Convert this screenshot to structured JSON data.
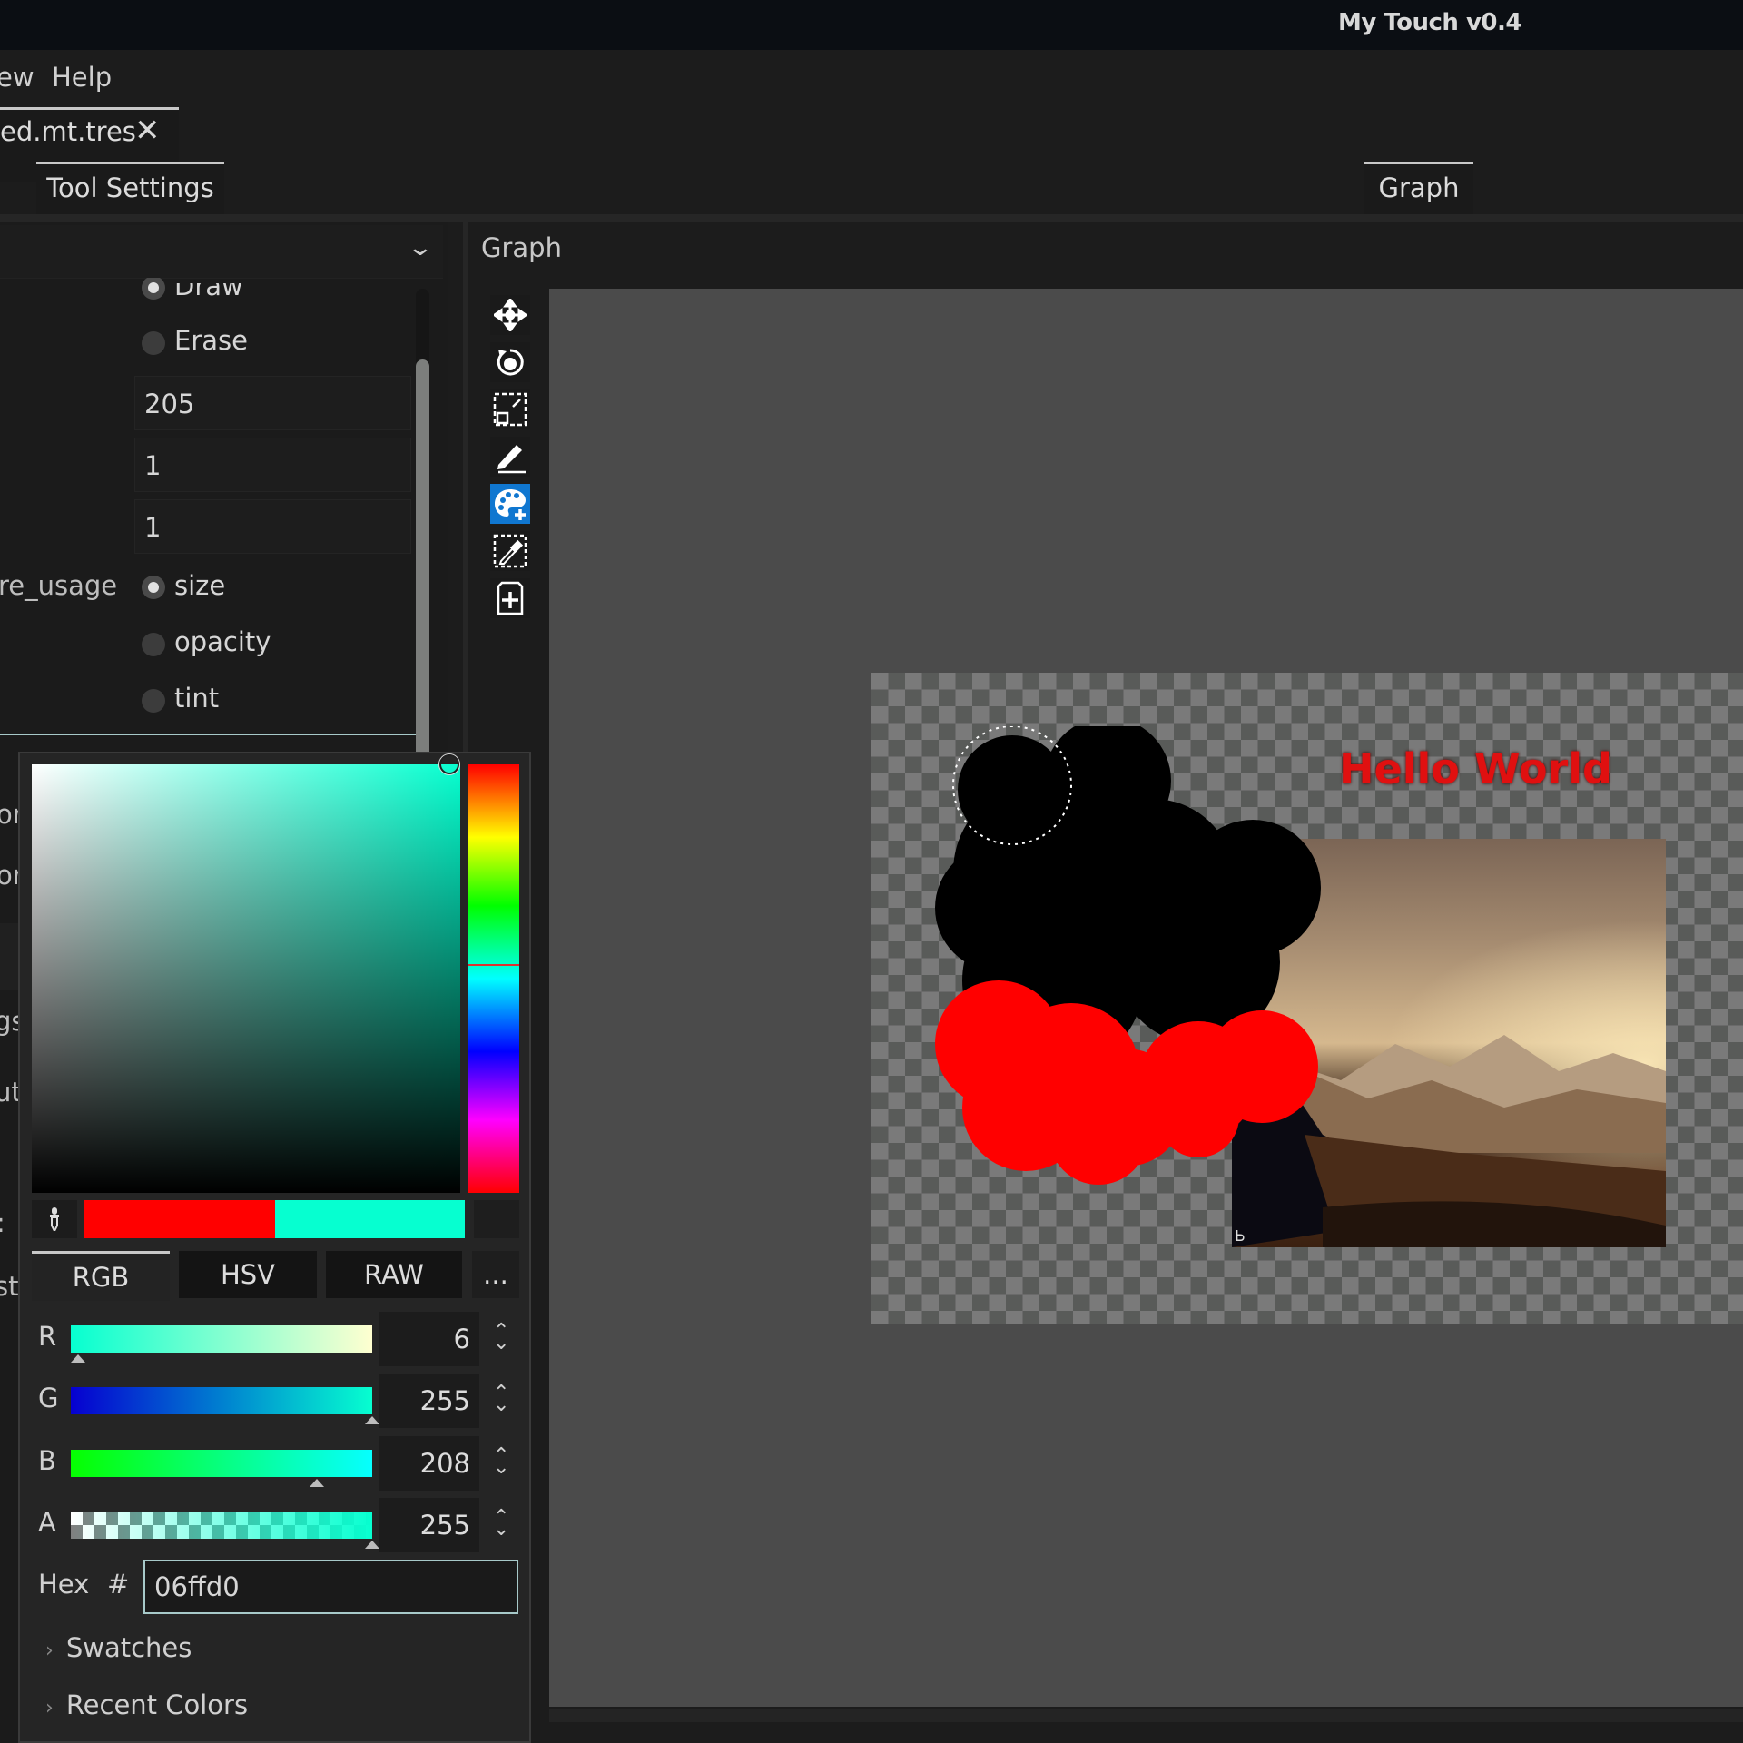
{
  "window": {
    "title": "My Touch v0.4"
  },
  "menu": {
    "items": [
      "ew",
      "Help"
    ]
  },
  "file_tab": {
    "label": "ed.mt.tres",
    "close_icon": "close-icon"
  },
  "dock_tabs": {
    "left": "Tool Settings",
    "right": "Graph"
  },
  "tool_settings": {
    "mode_options": [
      {
        "label": "Draw",
        "selected": true
      },
      {
        "label": "Erase",
        "selected": false
      }
    ],
    "fields": [
      "205",
      "1",
      "1"
    ],
    "pressure_label": "re_usage",
    "pressure_options": [
      {
        "label": "size",
        "selected": true
      },
      {
        "label": "opacity",
        "selected": false
      },
      {
        "label": "tint",
        "selected": false
      }
    ],
    "truncated_labels": [
      "or",
      "or",
      "gs",
      "ut",
      ":",
      "ste"
    ]
  },
  "graph_panel": {
    "title": "Graph",
    "tools": [
      {
        "name": "move-icon",
        "active": false
      },
      {
        "name": "rotate-icon",
        "active": false
      },
      {
        "name": "scale-icon",
        "active": false
      },
      {
        "name": "pencil-icon",
        "active": false
      },
      {
        "name": "palette-add-icon",
        "active": true
      },
      {
        "name": "color-picker-icon",
        "active": false
      },
      {
        "name": "add-file-icon",
        "active": false
      }
    ],
    "canvas": {
      "text_layer": "Hello World",
      "text_color": "#e01010"
    }
  },
  "color_picker": {
    "old_color": "#ff0000",
    "new_color": "#06ffd0",
    "modes": [
      "RGB",
      "HSV",
      "RAW",
      "..."
    ],
    "active_mode": "RGB",
    "channels": [
      {
        "label": "R",
        "value": "6",
        "fraction": 0.024
      },
      {
        "label": "G",
        "value": "255",
        "fraction": 1.0
      },
      {
        "label": "B",
        "value": "208",
        "fraction": 0.816
      },
      {
        "label": "A",
        "value": "255",
        "fraction": 1.0
      }
    ],
    "hex_label": "Hex",
    "hex_hash": "#",
    "hex_value": "06ffd0",
    "sections": [
      "Swatches",
      "Recent Colors"
    ]
  }
}
